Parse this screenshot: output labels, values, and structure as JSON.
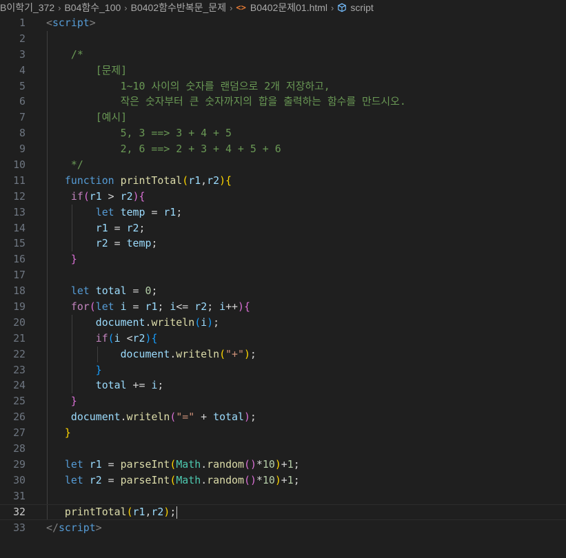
{
  "breadcrumb": [
    {
      "label": "B이학기_372",
      "icon": null
    },
    {
      "label": "B04함수_100",
      "icon": null
    },
    {
      "label": "B0402함수반복문_문제",
      "icon": null
    },
    {
      "label": "B0402문제01.html",
      "icon": "html-file-icon"
    },
    {
      "label": "script",
      "icon": "cube-icon"
    }
  ],
  "editor": {
    "current_line": 32,
    "lines": [
      {
        "n": "1",
        "tokens": [
          [
            "<",
            "punc"
          ],
          [
            "script",
            "tag"
          ],
          [
            ">",
            "punc"
          ]
        ]
      },
      {
        "n": "2",
        "tokens": []
      },
      {
        "n": "3",
        "tokens": [
          [
            "    /*",
            "cmt"
          ]
        ]
      },
      {
        "n": "4",
        "tokens": [
          [
            "        [문제]",
            "cmt"
          ]
        ]
      },
      {
        "n": "5",
        "tokens": [
          [
            "            1~10 사이의 숫자를 랜덤으로 2개 저장하고,",
            "cmt"
          ]
        ]
      },
      {
        "n": "6",
        "tokens": [
          [
            "            작은 숫자부터 큰 숫자까지의 합을 출력하는 함수를 만드시오.",
            "cmt"
          ]
        ]
      },
      {
        "n": "7",
        "tokens": [
          [
            "        [예시]",
            "cmt"
          ]
        ]
      },
      {
        "n": "8",
        "tokens": [
          [
            "            5, 3 ==> 3 + 4 + 5",
            "cmt"
          ]
        ]
      },
      {
        "n": "9",
        "tokens": [
          [
            "            2, 6 ==> 2 + 3 + 4 + 5 + 6",
            "cmt"
          ]
        ]
      },
      {
        "n": "10",
        "tokens": [
          [
            "    */",
            "cmt"
          ]
        ]
      },
      {
        "n": "11",
        "tokens": [
          [
            "   ",
            ""
          ],
          [
            "function",
            "kw"
          ],
          [
            " ",
            ""
          ],
          [
            "printTotal",
            "fn"
          ],
          [
            "(",
            "b1"
          ],
          [
            "r1",
            "var"
          ],
          [
            ",",
            ""
          ],
          [
            "r2",
            "var"
          ],
          [
            ")",
            "b1"
          ],
          [
            "{",
            "b1"
          ]
        ]
      },
      {
        "n": "12",
        "tokens": [
          [
            "    ",
            ""
          ],
          [
            "if",
            "ctl"
          ],
          [
            "(",
            "b2"
          ],
          [
            "r1",
            "var"
          ],
          [
            " > ",
            ""
          ],
          [
            "r2",
            "var"
          ],
          [
            ")",
            "b2"
          ],
          [
            "{",
            "b2"
          ]
        ]
      },
      {
        "n": "13",
        "tokens": [
          [
            "        ",
            ""
          ],
          [
            "let",
            "kw"
          ],
          [
            " ",
            ""
          ],
          [
            "temp",
            "var"
          ],
          [
            " = ",
            ""
          ],
          [
            "r1",
            "var"
          ],
          [
            ";",
            ""
          ]
        ]
      },
      {
        "n": "14",
        "tokens": [
          [
            "        ",
            ""
          ],
          [
            "r1",
            "var"
          ],
          [
            " = ",
            ""
          ],
          [
            "r2",
            "var"
          ],
          [
            ";",
            ""
          ]
        ]
      },
      {
        "n": "15",
        "tokens": [
          [
            "        ",
            ""
          ],
          [
            "r2",
            "var"
          ],
          [
            " = ",
            ""
          ],
          [
            "temp",
            "var"
          ],
          [
            ";",
            ""
          ]
        ]
      },
      {
        "n": "16",
        "tokens": [
          [
            "    ",
            ""
          ],
          [
            "}",
            "b2"
          ]
        ]
      },
      {
        "n": "17",
        "tokens": []
      },
      {
        "n": "18",
        "tokens": [
          [
            "    ",
            ""
          ],
          [
            "let",
            "kw"
          ],
          [
            " ",
            ""
          ],
          [
            "total",
            "var"
          ],
          [
            " = ",
            ""
          ],
          [
            "0",
            "num"
          ],
          [
            ";",
            ""
          ]
        ]
      },
      {
        "n": "19",
        "tokens": [
          [
            "    ",
            ""
          ],
          [
            "for",
            "ctl"
          ],
          [
            "(",
            "b2"
          ],
          [
            "let",
            "kw"
          ],
          [
            " ",
            ""
          ],
          [
            "i",
            "var"
          ],
          [
            " = ",
            ""
          ],
          [
            "r1",
            "var"
          ],
          [
            "; ",
            ""
          ],
          [
            "i",
            "var"
          ],
          [
            "<= ",
            ""
          ],
          [
            "r2",
            "var"
          ],
          [
            "; ",
            ""
          ],
          [
            "i",
            "var"
          ],
          [
            "++",
            ""
          ],
          [
            ")",
            "b2"
          ],
          [
            "{",
            "b2"
          ]
        ]
      },
      {
        "n": "20",
        "tokens": [
          [
            "        ",
            ""
          ],
          [
            "document",
            "var"
          ],
          [
            ".",
            ""
          ],
          [
            "writeln",
            "fn"
          ],
          [
            "(",
            "b3"
          ],
          [
            "i",
            "var"
          ],
          [
            ")",
            "b3"
          ],
          [
            ";",
            ""
          ]
        ]
      },
      {
        "n": "21",
        "tokens": [
          [
            "        ",
            ""
          ],
          [
            "if",
            "ctl"
          ],
          [
            "(",
            "b3"
          ],
          [
            "i",
            "var"
          ],
          [
            " <",
            ""
          ],
          [
            "r2",
            "var"
          ],
          [
            ")",
            "b3"
          ],
          [
            "{",
            "b3"
          ]
        ]
      },
      {
        "n": "22",
        "tokens": [
          [
            "            ",
            ""
          ],
          [
            "document",
            "var"
          ],
          [
            ".",
            ""
          ],
          [
            "writeln",
            "fn"
          ],
          [
            "(",
            "b1"
          ],
          [
            "\"+\"",
            "str"
          ],
          [
            ")",
            "b1"
          ],
          [
            ";",
            ""
          ]
        ]
      },
      {
        "n": "23",
        "tokens": [
          [
            "        ",
            ""
          ],
          [
            "}",
            "b3"
          ]
        ]
      },
      {
        "n": "24",
        "tokens": [
          [
            "        ",
            ""
          ],
          [
            "total",
            "var"
          ],
          [
            " += ",
            ""
          ],
          [
            "i",
            "var"
          ],
          [
            ";",
            ""
          ]
        ]
      },
      {
        "n": "25",
        "tokens": [
          [
            "    ",
            ""
          ],
          [
            "}",
            "b2"
          ]
        ]
      },
      {
        "n": "26",
        "tokens": [
          [
            "    ",
            ""
          ],
          [
            "document",
            "var"
          ],
          [
            ".",
            ""
          ],
          [
            "writeln",
            "fn"
          ],
          [
            "(",
            "b2"
          ],
          [
            "\"=\"",
            "str"
          ],
          [
            " + ",
            ""
          ],
          [
            "total",
            "var"
          ],
          [
            ")",
            "b2"
          ],
          [
            ";",
            ""
          ]
        ]
      },
      {
        "n": "27",
        "tokens": [
          [
            "   ",
            ""
          ],
          [
            "}",
            "b1"
          ]
        ]
      },
      {
        "n": "28",
        "tokens": []
      },
      {
        "n": "29",
        "tokens": [
          [
            "   ",
            ""
          ],
          [
            "let",
            "kw"
          ],
          [
            " ",
            ""
          ],
          [
            "r1",
            "var"
          ],
          [
            " = ",
            ""
          ],
          [
            "parseInt",
            "fn"
          ],
          [
            "(",
            "b1"
          ],
          [
            "Math",
            "cls"
          ],
          [
            ".",
            ""
          ],
          [
            "random",
            "fn"
          ],
          [
            "(",
            "b2"
          ],
          [
            ")",
            "b2"
          ],
          [
            "*",
            ""
          ],
          [
            "10",
            "num"
          ],
          [
            ")",
            "b1"
          ],
          [
            "+",
            ""
          ],
          [
            "1",
            "num"
          ],
          [
            ";",
            ""
          ]
        ]
      },
      {
        "n": "30",
        "tokens": [
          [
            "   ",
            ""
          ],
          [
            "let",
            "kw"
          ],
          [
            " ",
            ""
          ],
          [
            "r2",
            "var"
          ],
          [
            " = ",
            ""
          ],
          [
            "parseInt",
            "fn"
          ],
          [
            "(",
            "b1"
          ],
          [
            "Math",
            "cls"
          ],
          [
            ".",
            ""
          ],
          [
            "random",
            "fn"
          ],
          [
            "(",
            "b2"
          ],
          [
            ")",
            "b2"
          ],
          [
            "*",
            ""
          ],
          [
            "10",
            "num"
          ],
          [
            ")",
            "b1"
          ],
          [
            "+",
            ""
          ],
          [
            "1",
            "num"
          ],
          [
            ";",
            ""
          ]
        ]
      },
      {
        "n": "31",
        "tokens": []
      },
      {
        "n": "32",
        "tokens": [
          [
            "   ",
            ""
          ],
          [
            "printTotal",
            "fn"
          ],
          [
            "(",
            "b1"
          ],
          [
            "r1",
            "var"
          ],
          [
            ",",
            ""
          ],
          [
            "r2",
            "var"
          ],
          [
            ")",
            "b1"
          ],
          [
            ";",
            ""
          ]
        ]
      },
      {
        "n": "33",
        "tokens": [
          [
            "</",
            "punc"
          ],
          [
            "script",
            "tag"
          ],
          [
            ">",
            "punc"
          ]
        ]
      }
    ]
  }
}
